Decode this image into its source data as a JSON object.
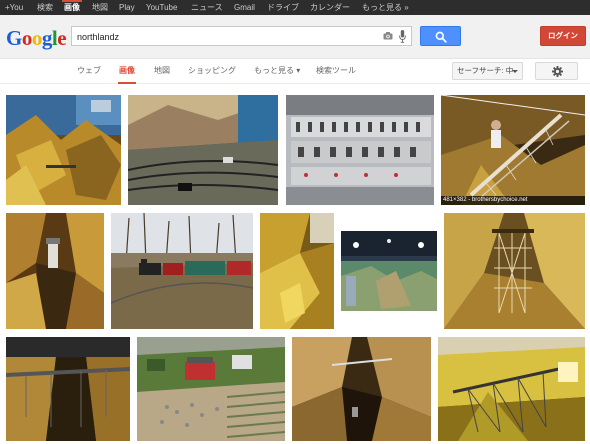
{
  "topbar": {
    "items": [
      "+You",
      "検索",
      "画像",
      "地図",
      "Play",
      "YouTube",
      "ニュース",
      "Gmail",
      "ドライブ",
      "カレンダー",
      "もっと見る »"
    ],
    "active_index": 2
  },
  "header": {
    "logo_letters": [
      "G",
      "o",
      "o",
      "g",
      "l",
      "e"
    ],
    "search_value": "northlandz",
    "login_label": "ログイン"
  },
  "tabs": {
    "items": [
      "ウェブ",
      "画像",
      "地図",
      "ショッピング",
      "もっと見る ▾",
      "検索ツール"
    ],
    "active_index": 1,
    "safesearch_label": "セーフサーチ: 中"
  },
  "results": {
    "caption": "481×382 - brothersbychoice.net",
    "image_labels": [
      "railroad canyon model layout",
      "model railroad yard tracks",
      "control panel switches",
      "trestle bridge with man",
      "rocky gorge with stairs",
      "steam train on outdoor track",
      "yellow rock canyon",
      "model layout hall with lights",
      "wooden trestle in gorge",
      "trestle over canyon",
      "miniature village with figures",
      "deep canyon with bridge",
      "illuminated trestle bridge"
    ]
  },
  "colors": {
    "accent_red": "#dd4b39",
    "search_blue": "#4d90fe",
    "login_red": "#d14836"
  }
}
